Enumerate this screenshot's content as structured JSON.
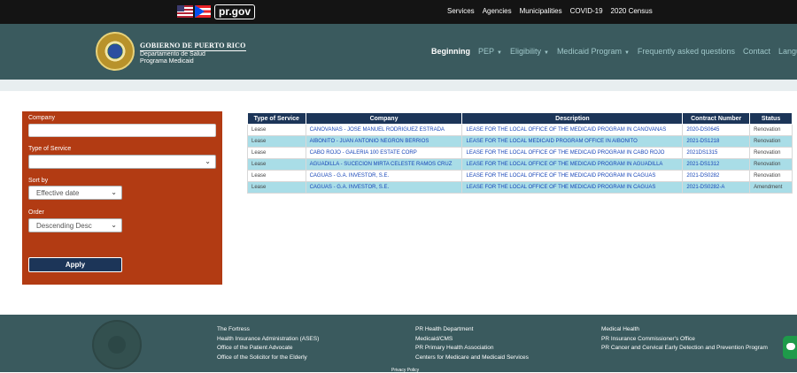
{
  "topbar": {
    "logo_text": "pr.gov",
    "nav": [
      "Services",
      "Agencies",
      "Municipalities",
      "COVID-19",
      "2020 Census"
    ]
  },
  "header": {
    "title": "GOBIERNO DE PUERTO RICO",
    "subtitle1": "Departamento de Salud",
    "subtitle2": "Programa Medicaid",
    "nav": {
      "beginning": "Beginning",
      "pep": "PEP",
      "eligibility": "Eligibility",
      "medicaid": "Medicaid Program",
      "faq": "Frequently asked questions",
      "contact": "Contact",
      "language": "Language"
    }
  },
  "filters": {
    "company_label": "Company",
    "company_value": "",
    "service_label": "Type of Service",
    "service_value": "",
    "sort_label": "Sort by",
    "sort_value": "Effective date",
    "order_label": "Order",
    "order_value": "Descending Desc",
    "apply_label": "Apply"
  },
  "table": {
    "headers": [
      "Type of Service",
      "Company",
      "Description",
      "Contract Number",
      "Status"
    ],
    "rows": [
      [
        "Lease",
        "CANOVANAS - JOSE MANUEL RODRIGUEZ ESTRADA",
        "LEASE FOR THE LOCAL OFFICE OF THE MEDICAID PROGRAM IN CANOVANAS",
        "2020-DS0645",
        "Renovation"
      ],
      [
        "Lease",
        "AIBONITO - JUAN ANTONIO NEGRON BERRIOS",
        "LEASE FOR THE LOCAL MEDICAID PROGRAM OFFICE IN AIBONITO",
        "2021-DS1218",
        "Renovation"
      ],
      [
        "Lease",
        "CABO ROJO - GALERIA 100 ESTATE CORP",
        "LEASE FOR THE LOCAL OFFICE OF THE MEDICAID PROGRAM IN CABO ROJO",
        "2021DS1315",
        "Renovation"
      ],
      [
        "Lease",
        "AGUADILLA - SUCECION MIRTA CELESTE RAMOS CRUZ",
        "LEASE FOR THE LOCAL OFFICE OF THE MEDICAID PROGRAM IN AGUADILLA",
        "2021-DS1312",
        "Renovation"
      ],
      [
        "Lease",
        "CAGUAS - G.A. INVESTOR, S.E.",
        "LEASE FOR THE LOCAL OFFICE OF THE MEDICAID PROGRAM IN CAGUAS",
        "2021-DS0282",
        "Renovation"
      ],
      [
        "Lease",
        "CAGUAS - G.A. INVESTOR, S.E.",
        "LEASE FOR THE LOCAL OFFICE OF THE MEDICAID PROGRAM IN CAGUAS",
        "2021-DS0282-A",
        "Amendment"
      ]
    ]
  },
  "footer": {
    "col1": [
      "The Fortress",
      "Health Insurance Administration (ASES)",
      "Office of the Patient Advocate",
      "Office of the Solicitor for the Elderly"
    ],
    "col2": [
      "PR Health Department",
      "Medicaid/CMS",
      "PR Primary Health Association",
      "Centers for Medicare and Medicaid Services"
    ],
    "col3": [
      "Medical Health",
      "PR Insurance Commissioner's Office",
      "PR Cancer and Cervical Early Detection and Prevention Program"
    ],
    "privacy": "Privacy Policy"
  },
  "icons": {
    "us_flag": "us-flag-icon",
    "pr_flag": "pr-flag-icon",
    "seal": "government-seal-icon",
    "chat": "chat-icon"
  },
  "colors": {
    "header_bg": "#3a5a5e",
    "panel_bg": "#b23b13",
    "table_header": "#1c3558",
    "row_highlight": "#a9dde7",
    "link": "#1846b8"
  }
}
